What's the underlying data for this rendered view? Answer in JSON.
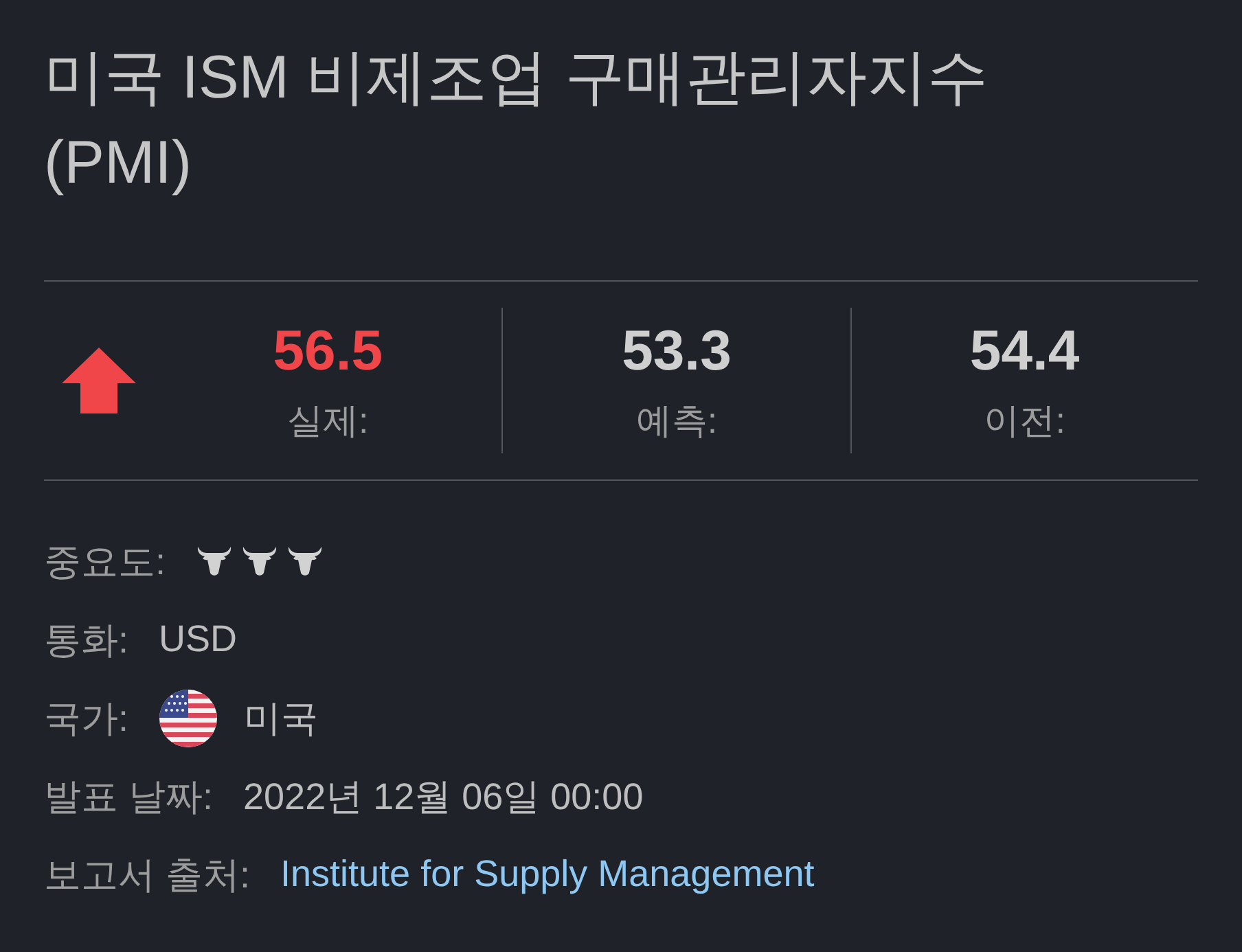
{
  "title": "미국 ISM 비제조업 구매관리자지수 (PMI)",
  "summary": {
    "rising": true,
    "stats": [
      {
        "kind": "actual",
        "value": "56.5",
        "label": "실제:"
      },
      {
        "kind": "forecast",
        "value": "53.3",
        "label": "예측:"
      },
      {
        "kind": "previous",
        "value": "54.4",
        "label": "이전:"
      }
    ]
  },
  "details": [
    {
      "kind": "importance",
      "label": "중요도:",
      "stars": 3
    },
    {
      "kind": "text",
      "label": "통화:",
      "value": "USD"
    },
    {
      "kind": "country",
      "label": "국가:",
      "value": "미국"
    },
    {
      "kind": "text",
      "label": "발표 날짜:",
      "value": "2022년 12월 06일 00:00"
    },
    {
      "kind": "link",
      "label": "보고서 출처:",
      "value": "Institute for Supply Management"
    }
  ]
}
